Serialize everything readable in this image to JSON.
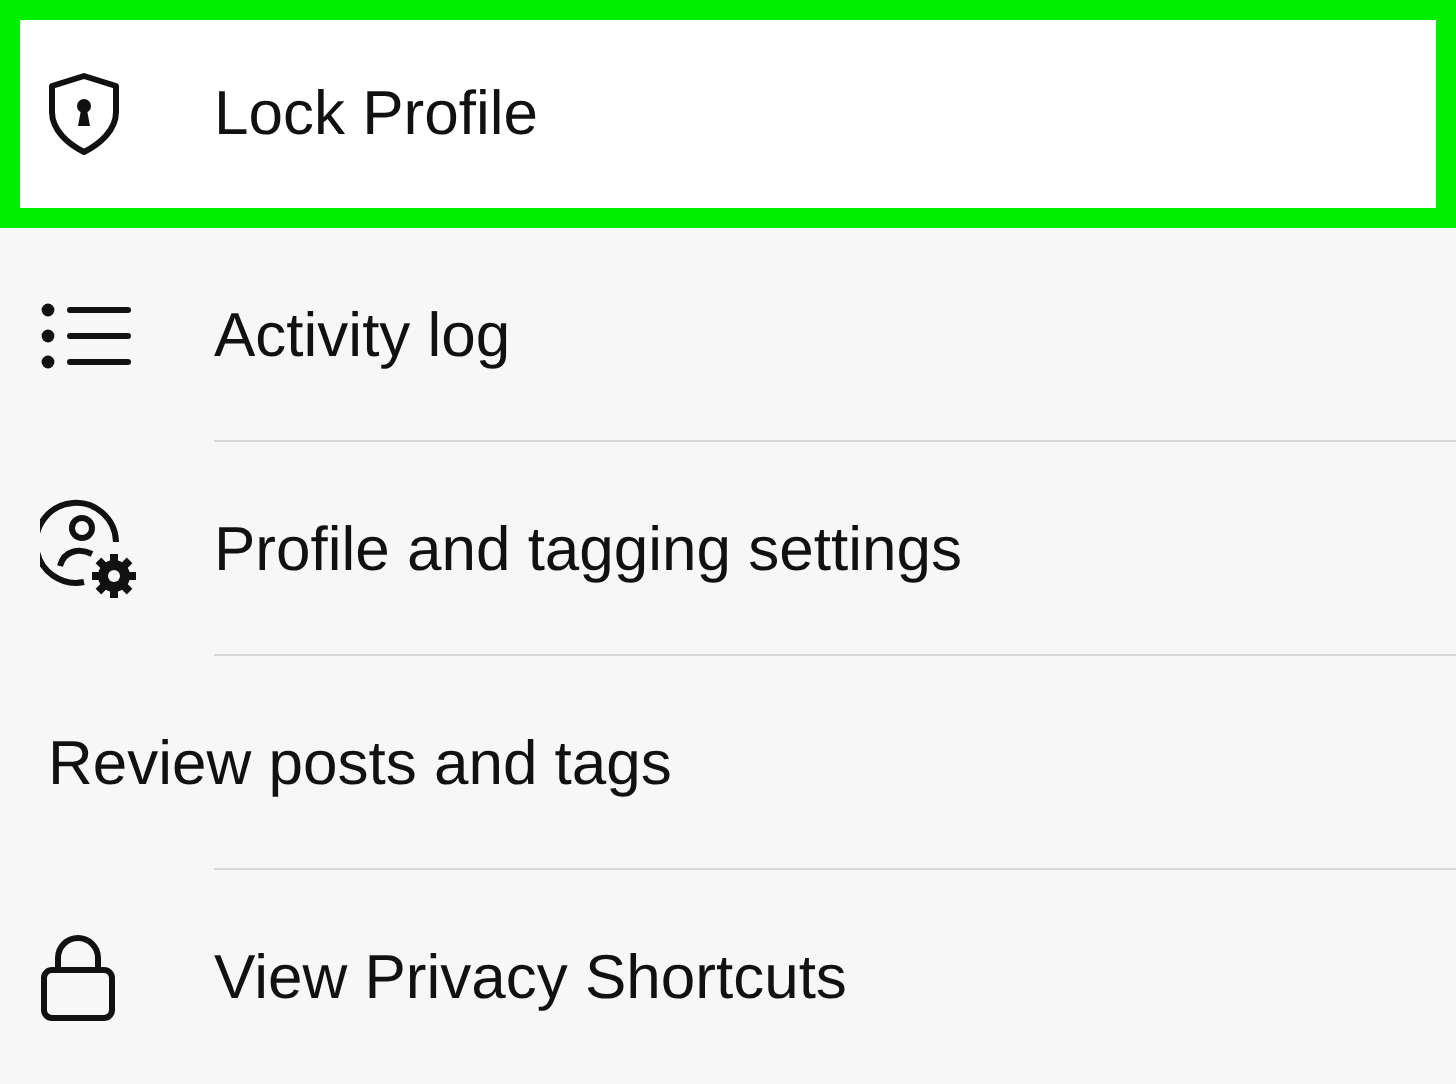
{
  "menu": {
    "items": [
      {
        "label": "Lock Profile",
        "selected": true
      },
      {
        "label": "Activity log",
        "selected": false
      },
      {
        "label": "Profile and tagging settings",
        "selected": false
      },
      {
        "label": "Review posts and tags",
        "selected": false
      },
      {
        "label": "View Privacy Shortcuts",
        "selected": false
      }
    ]
  }
}
